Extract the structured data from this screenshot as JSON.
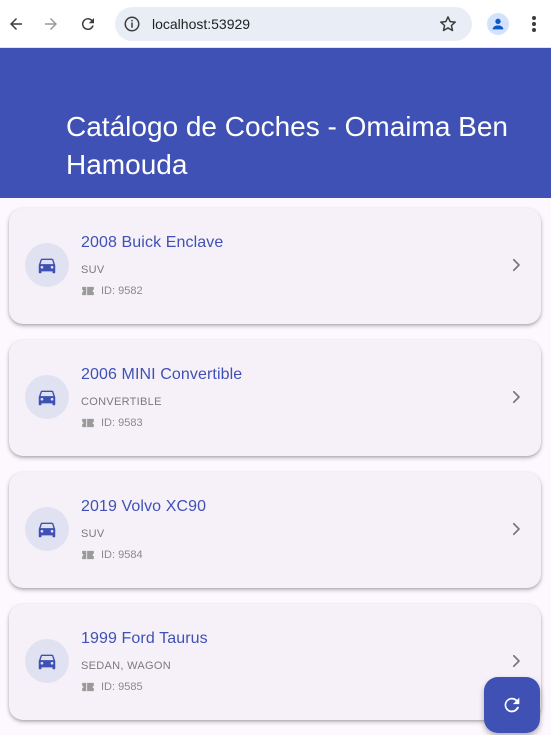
{
  "browser": {
    "url": "localhost:53929"
  },
  "app": {
    "title": "Catálogo de Coches - Omaima Ben Hamouda",
    "accent_color": "#3f51b5"
  },
  "cars": [
    {
      "title": "2008 Buick Enclave",
      "type": "SUV",
      "id": "ID: 9582"
    },
    {
      "title": "2006 MINI Convertible",
      "type": "CONVERTIBLE",
      "id": "ID: 9583"
    },
    {
      "title": "2019 Volvo XC90",
      "type": "SUV",
      "id": "ID: 9584"
    },
    {
      "title": "1999 Ford Taurus",
      "type": "SEDAN, WAGON",
      "id": "ID: 9585"
    }
  ],
  "icons": {
    "back": "arrow-back-icon",
    "forward": "arrow-forward-icon",
    "reload": "reload-icon",
    "site_info": "info-icon",
    "bookmark": "star-icon",
    "profile": "person-icon",
    "menu": "more-vert-icon",
    "car": "car-icon",
    "id": "ticket-icon",
    "open": "chevron-right-icon",
    "refresh": "refresh-icon"
  }
}
